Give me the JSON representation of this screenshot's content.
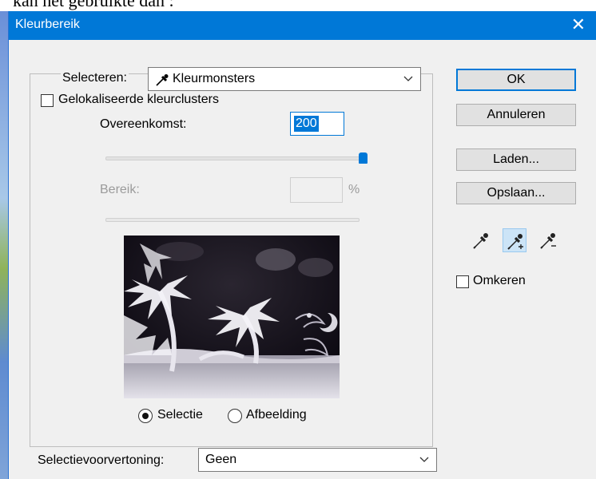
{
  "background": {
    "doc_text": "kan het gebruikte dan :"
  },
  "dialog": {
    "title": "Kleurbereik",
    "close_icon": "close-icon",
    "select_label": "Selecteren:",
    "select_value": "Kleurmonsters",
    "localized_label": "Gelokaliseerde kleurclusters",
    "localized_checked": false,
    "fuzziness_label": "Overeenkomst:",
    "fuzziness_value": "200",
    "fuzziness_slider_fraction": 1.0,
    "range_label": "Bereik:",
    "range_value": "",
    "range_unit": "%",
    "preview_mode": "selection",
    "radio_selection_label": "Selectie",
    "radio_image_label": "Afbeelding",
    "preview_label": "Selectievoorvertoning:",
    "preview_value": "Geen",
    "buttons": {
      "ok": "OK",
      "cancel": "Annuleren",
      "load": "Laden...",
      "save": "Opslaan..."
    },
    "eyedroppers": [
      "eyedropper-icon",
      "eyedropper-plus-icon",
      "eyedropper-minus-icon"
    ],
    "active_eyedropper": "eyedropper-plus-icon",
    "invert_label": "Omkeren",
    "invert_checked": false
  },
  "colors": {
    "titlebar": "#0078d7",
    "accent": "#0078d7",
    "dialog_bg": "#f0f0f0"
  }
}
